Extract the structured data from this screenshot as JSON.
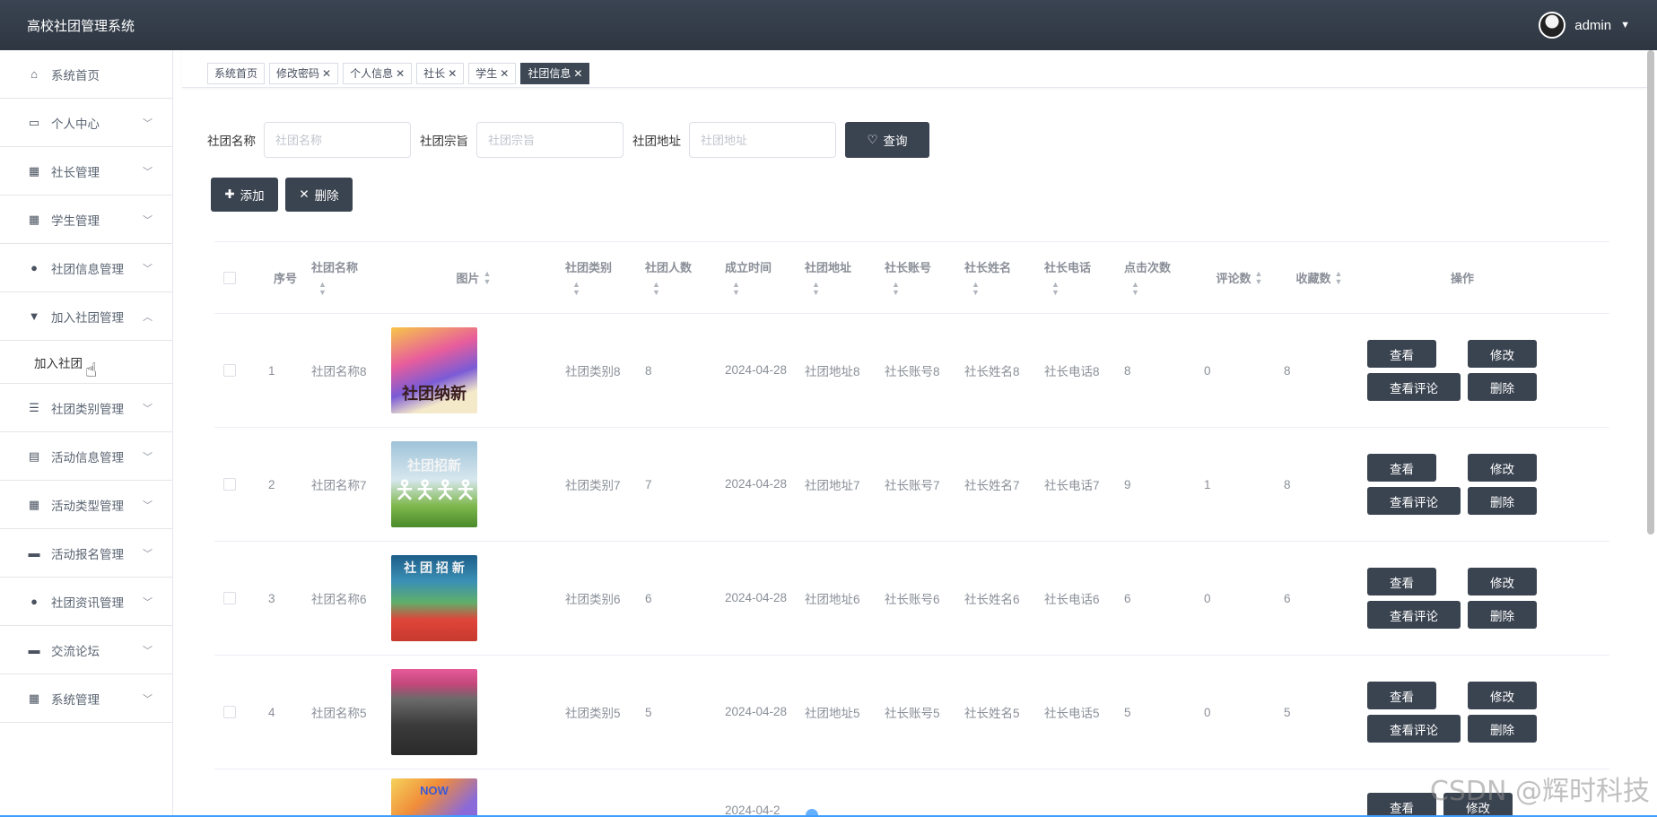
{
  "app": {
    "title": "高校社团管理系统",
    "user": "admin"
  },
  "sidebar": {
    "items": [
      {
        "label": "系统首页",
        "icon": "home-icon"
      },
      {
        "label": "个人中心",
        "icon": "card-icon"
      },
      {
        "label": "社长管理",
        "icon": "grid-icon"
      },
      {
        "label": "学生管理",
        "icon": "grid-icon"
      },
      {
        "label": "社团信息管理",
        "icon": "user-icon"
      },
      {
        "label": "加入社团管理",
        "icon": "flag-icon"
      },
      {
        "label": "社团类别管理",
        "icon": "list-icon"
      },
      {
        "label": "活动信息管理",
        "icon": "clipboard-icon"
      },
      {
        "label": "活动类型管理",
        "icon": "grid-icon"
      },
      {
        "label": "活动报名管理",
        "icon": "monitor-icon"
      },
      {
        "label": "社团资讯管理",
        "icon": "user-icon"
      },
      {
        "label": "交流论坛",
        "icon": "monitor-icon"
      },
      {
        "label": "系统管理",
        "icon": "grid-icon"
      }
    ],
    "submenu": {
      "label": "加入社团"
    }
  },
  "tags": [
    "系统首页",
    "修改密码",
    "个人信息",
    "社长",
    "学生",
    "社团信息"
  ],
  "search": {
    "name_label": "社团名称",
    "name_placeholder": "社团名称",
    "purpose_label": "社团宗旨",
    "purpose_placeholder": "社团宗旨",
    "addr_label": "社团地址",
    "addr_placeholder": "社团地址",
    "query_label": "查询"
  },
  "actions": {
    "add_label": "添加",
    "delete_label": "删除"
  },
  "table": {
    "headers": {
      "no": "序号",
      "name": "社团名称",
      "img": "图片",
      "type": "社团类别",
      "num": "社团人数",
      "date": "成立时间",
      "addr": "社团地址",
      "acc": "社长账号",
      "lname": "社长姓名",
      "tel": "社长电话",
      "clk": "点击次数",
      "cmt": "评论数",
      "fav": "收藏数",
      "ops": "操作"
    },
    "rows": [
      {
        "no": "1",
        "name": "社团名称8",
        "type": "社团类别8",
        "num": "8",
        "date": "2024-04-28",
        "addr": "社团地址8",
        "acc": "社长账号8",
        "lname": "社长姓名8",
        "tel": "社长电话8",
        "clk": "8",
        "cmt": "0",
        "fav": "8",
        "img_text": "社团纳新"
      },
      {
        "no": "2",
        "name": "社团名称7",
        "type": "社团类别7",
        "num": "7",
        "date": "2024-04-28",
        "addr": "社团地址7",
        "acc": "社长账号7",
        "lname": "社长姓名7",
        "tel": "社长电话7",
        "clk": "9",
        "cmt": "1",
        "fav": "8",
        "img_text": "社团招新"
      },
      {
        "no": "3",
        "name": "社团名称6",
        "type": "社团类别6",
        "num": "6",
        "date": "2024-04-28",
        "addr": "社团地址6",
        "acc": "社长账号6",
        "lname": "社长姓名6",
        "tel": "社长电话6",
        "clk": "6",
        "cmt": "0",
        "fav": "6",
        "img_text": "社 团 招 新"
      },
      {
        "no": "4",
        "name": "社团名称5",
        "type": "社团类别5",
        "num": "5",
        "date": "2024-04-28",
        "addr": "社团地址5",
        "acc": "社长账号5",
        "lname": "社长姓名5",
        "tel": "社长电话5",
        "clk": "5",
        "cmt": "0",
        "fav": "5",
        "img_text": ""
      }
    ],
    "partial_row": {
      "date": "2024-04-2",
      "img_text": "NOW"
    },
    "op_labels": {
      "view": "查看",
      "edit": "修改",
      "view_comments": "查看评论",
      "delete": "删除"
    }
  },
  "watermark": "CSDN @辉时科技",
  "colors": {
    "topbar": "#2e3641",
    "button": "#3a4350",
    "accent": "#409eff"
  }
}
